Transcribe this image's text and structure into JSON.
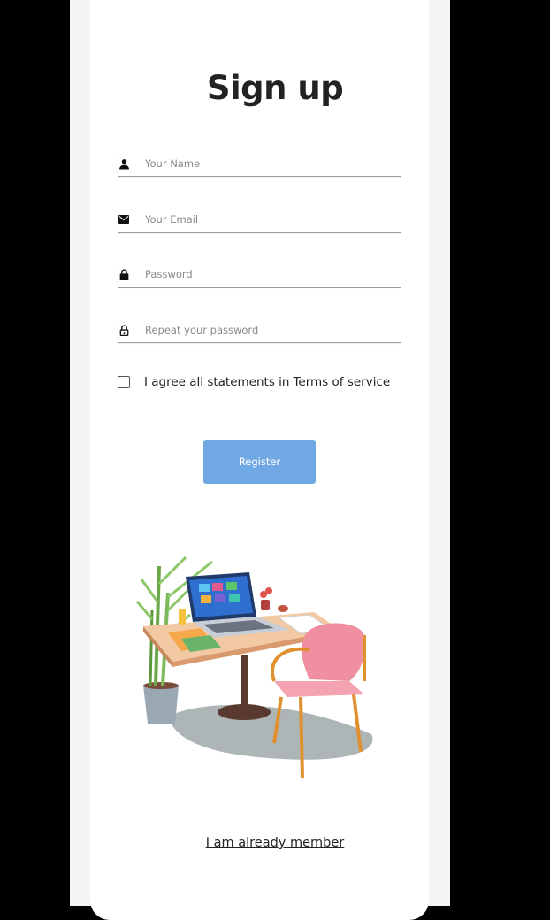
{
  "form": {
    "title": "Sign up",
    "fields": [
      {
        "icon": "person-icon",
        "placeholder": "Your Name",
        "value": ""
      },
      {
        "icon": "email-icon",
        "placeholder": "Your Email",
        "value": ""
      },
      {
        "icon": "lock-icon",
        "placeholder": "Password",
        "value": ""
      },
      {
        "icon": "lock-outline-icon",
        "placeholder": "Repeat your password",
        "value": ""
      }
    ],
    "agree_text": "I agree all statements in",
    "terms_label": "Terms of service",
    "agree_checked": false,
    "register_label": "Register",
    "member_link": "I am already member"
  },
  "colors": {
    "accent": "#6fa8e3",
    "text": "#222222",
    "placeholder": "#8a8a8a",
    "background": "#f5f5f5",
    "card": "#ffffff"
  }
}
